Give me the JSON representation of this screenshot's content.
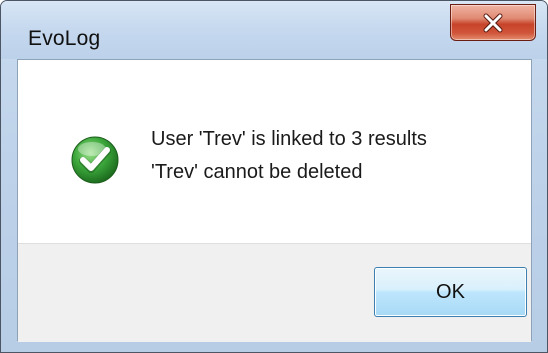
{
  "window": {
    "title": "EvoLog",
    "close_icon": "close-icon"
  },
  "message": {
    "icon": "check-icon",
    "line1": "User 'Trev' is linked to 3 results",
    "line2": "'Trev' cannot be deleted"
  },
  "buttons": {
    "ok_label": "OK"
  },
  "colors": {
    "close_red": "#c7432a",
    "check_green": "#3aa63a",
    "button_blue": "#3c7fb1",
    "footer_gray": "#f0f0f0"
  }
}
